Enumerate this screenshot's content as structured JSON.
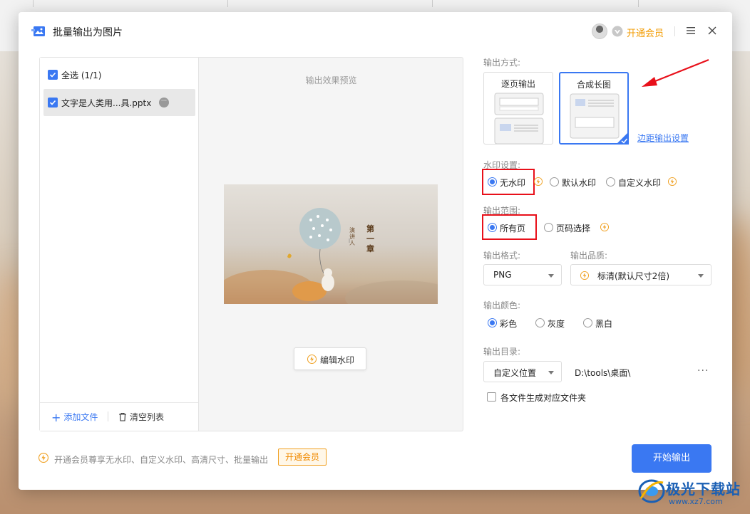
{
  "dialog": {
    "title": "批量输出为图片",
    "vip_label": "开通会员"
  },
  "file_list": {
    "select_all": "全选 (1/1)",
    "files": [
      {
        "name": "文字是人类用...具.pptx"
      }
    ],
    "add_file": "添加文件",
    "clear_list": "清空列表"
  },
  "preview": {
    "title": "输出效果预览",
    "image_text": {
      "chapter": "第一章",
      "speaker": "演讲人"
    },
    "edit_watermark": "编辑水印"
  },
  "settings": {
    "output_mode": {
      "label": "输出方式:",
      "options": [
        "逐页输出",
        "合成长图"
      ],
      "selected": "合成长图",
      "margin_link": "边距输出设置"
    },
    "watermark": {
      "label": "水印设置:",
      "options": [
        "无水印",
        "默认水印",
        "自定义水印"
      ],
      "selected": "无水印"
    },
    "range": {
      "label": "输出范围:",
      "options": [
        "所有页",
        "页码选择"
      ],
      "selected": "所有页"
    },
    "format": {
      "label": "输出格式:",
      "value": "PNG"
    },
    "quality": {
      "label": "输出品质:",
      "value": "标清(默认尺寸2倍)"
    },
    "color": {
      "label": "输出颜色:",
      "options": [
        "彩色",
        "灰度",
        "黑白"
      ],
      "selected": "彩色"
    },
    "directory": {
      "label": "输出目录:",
      "mode": "自定义位置",
      "path": "D:\\tools\\桌面\\",
      "more": "···"
    },
    "per_file_folder": {
      "label": "各文件生成对应文件夹",
      "checked": false
    }
  },
  "footer": {
    "tip": "开通会员尊享无水印、自定义水印、高清尺寸、批量输出",
    "vip_button": "开通会员",
    "start_button": "开始输出"
  },
  "site_watermark": {
    "name": "极光下载站",
    "url": "www.xz7.com"
  },
  "colors": {
    "accent": "#3a78f2",
    "vip": "#f29b00",
    "highlight": "#e8101a"
  }
}
